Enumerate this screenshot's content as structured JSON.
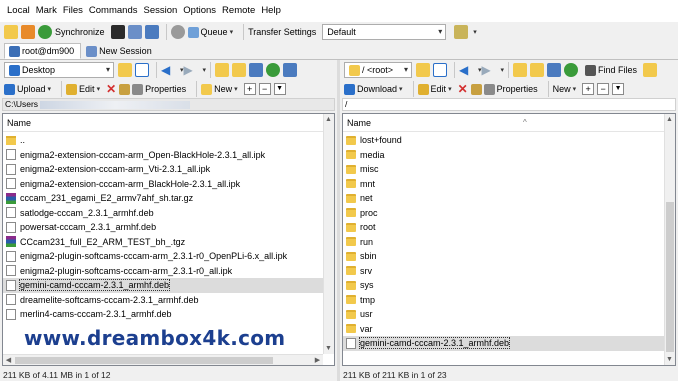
{
  "menubar": {
    "items": [
      "Local",
      "Mark",
      "Files",
      "Commands",
      "Session",
      "Options",
      "Remote",
      "Help"
    ]
  },
  "toolbar": {
    "synchronize": "Synchronize",
    "queue": "Queue",
    "transfer_settings_label": "Transfer Settings",
    "transfer_settings_value": "Default"
  },
  "tabs": {
    "session": "root@dm900",
    "new_session": "New Session"
  },
  "left": {
    "location": "Desktop",
    "upload": "Upload",
    "edit": "Edit",
    "properties": "Properties",
    "new": "New",
    "path": "C:\\Users",
    "column_name": "Name",
    "files": [
      {
        "name": "..",
        "icon": "up"
      },
      {
        "name": "enigma2-extension-cccam-arm_Open-BlackHole-2.3.1_all.ipk",
        "icon": "doc"
      },
      {
        "name": "enigma2-extension-cccam-arm_Vti-2.3.1_all.ipk",
        "icon": "doc"
      },
      {
        "name": "enigma2-extension-cccam-arm_BlackHole-2.3.1_all.ipk",
        "icon": "doc"
      },
      {
        "name": "cccam_231_egami_E2_armv7ahf_sh.tar.gz",
        "icon": "rar"
      },
      {
        "name": "satlodge-cccam_2.3.1_armhf.deb",
        "icon": "doc"
      },
      {
        "name": "powersat-cccam_2.3.1_armhf.deb",
        "icon": "doc"
      },
      {
        "name": "CCcam231_full_E2_ARM_TEST_bh_.tgz",
        "icon": "rar"
      },
      {
        "name": "enigma2-plugin-softcams-cccam-arm_2.3.1-r0_OpenPLi-6.x_all.ipk",
        "icon": "doc"
      },
      {
        "name": "enigma2-plugin-softcams-cccam-arm_2.3.1-r0_all.ipk",
        "icon": "doc"
      },
      {
        "name": "gemini-camd-cccam-2.3.1_armhf.deb",
        "icon": "doc",
        "selected": true
      },
      {
        "name": "dreamelite-softcams-cccam-2.3.1_armhf.deb",
        "icon": "doc"
      },
      {
        "name": "merlin4-cams-cccam-2.3.1_armhf.deb",
        "icon": "doc"
      }
    ],
    "status": "211 KB of 4.11 MB in 1 of 12"
  },
  "right": {
    "location": "/ <root>",
    "find_files": "Find Files",
    "download": "Download",
    "edit": "Edit",
    "properties": "Properties",
    "new": "New",
    "path": "/",
    "column_name": "Name",
    "files": [
      {
        "name": "lost+found",
        "icon": "folder"
      },
      {
        "name": "media",
        "icon": "folder"
      },
      {
        "name": "misc",
        "icon": "folder"
      },
      {
        "name": "mnt",
        "icon": "folder"
      },
      {
        "name": "net",
        "icon": "folder"
      },
      {
        "name": "proc",
        "icon": "folder"
      },
      {
        "name": "root",
        "icon": "folder"
      },
      {
        "name": "run",
        "icon": "folder"
      },
      {
        "name": "sbin",
        "icon": "folder"
      },
      {
        "name": "srv",
        "icon": "folder"
      },
      {
        "name": "sys",
        "icon": "folder"
      },
      {
        "name": "tmp",
        "icon": "folder"
      },
      {
        "name": "usr",
        "icon": "folder"
      },
      {
        "name": "var",
        "icon": "folder"
      },
      {
        "name": "gemini-camd-cccam-2.3.1_armhf.deb",
        "icon": "doc",
        "selected": true
      }
    ],
    "status": "211 KB of 211 KB in 1 of 23"
  },
  "watermark": "www.dreambox4k.com",
  "colors": {
    "folder": "#f2c94c",
    "selected_row": "#dcdcdc",
    "watermark": "#1c3f8f",
    "accent_blue": "#2a6fc9",
    "delete_red": "#d32f2f",
    "sync_green": "#3a9b3a"
  }
}
